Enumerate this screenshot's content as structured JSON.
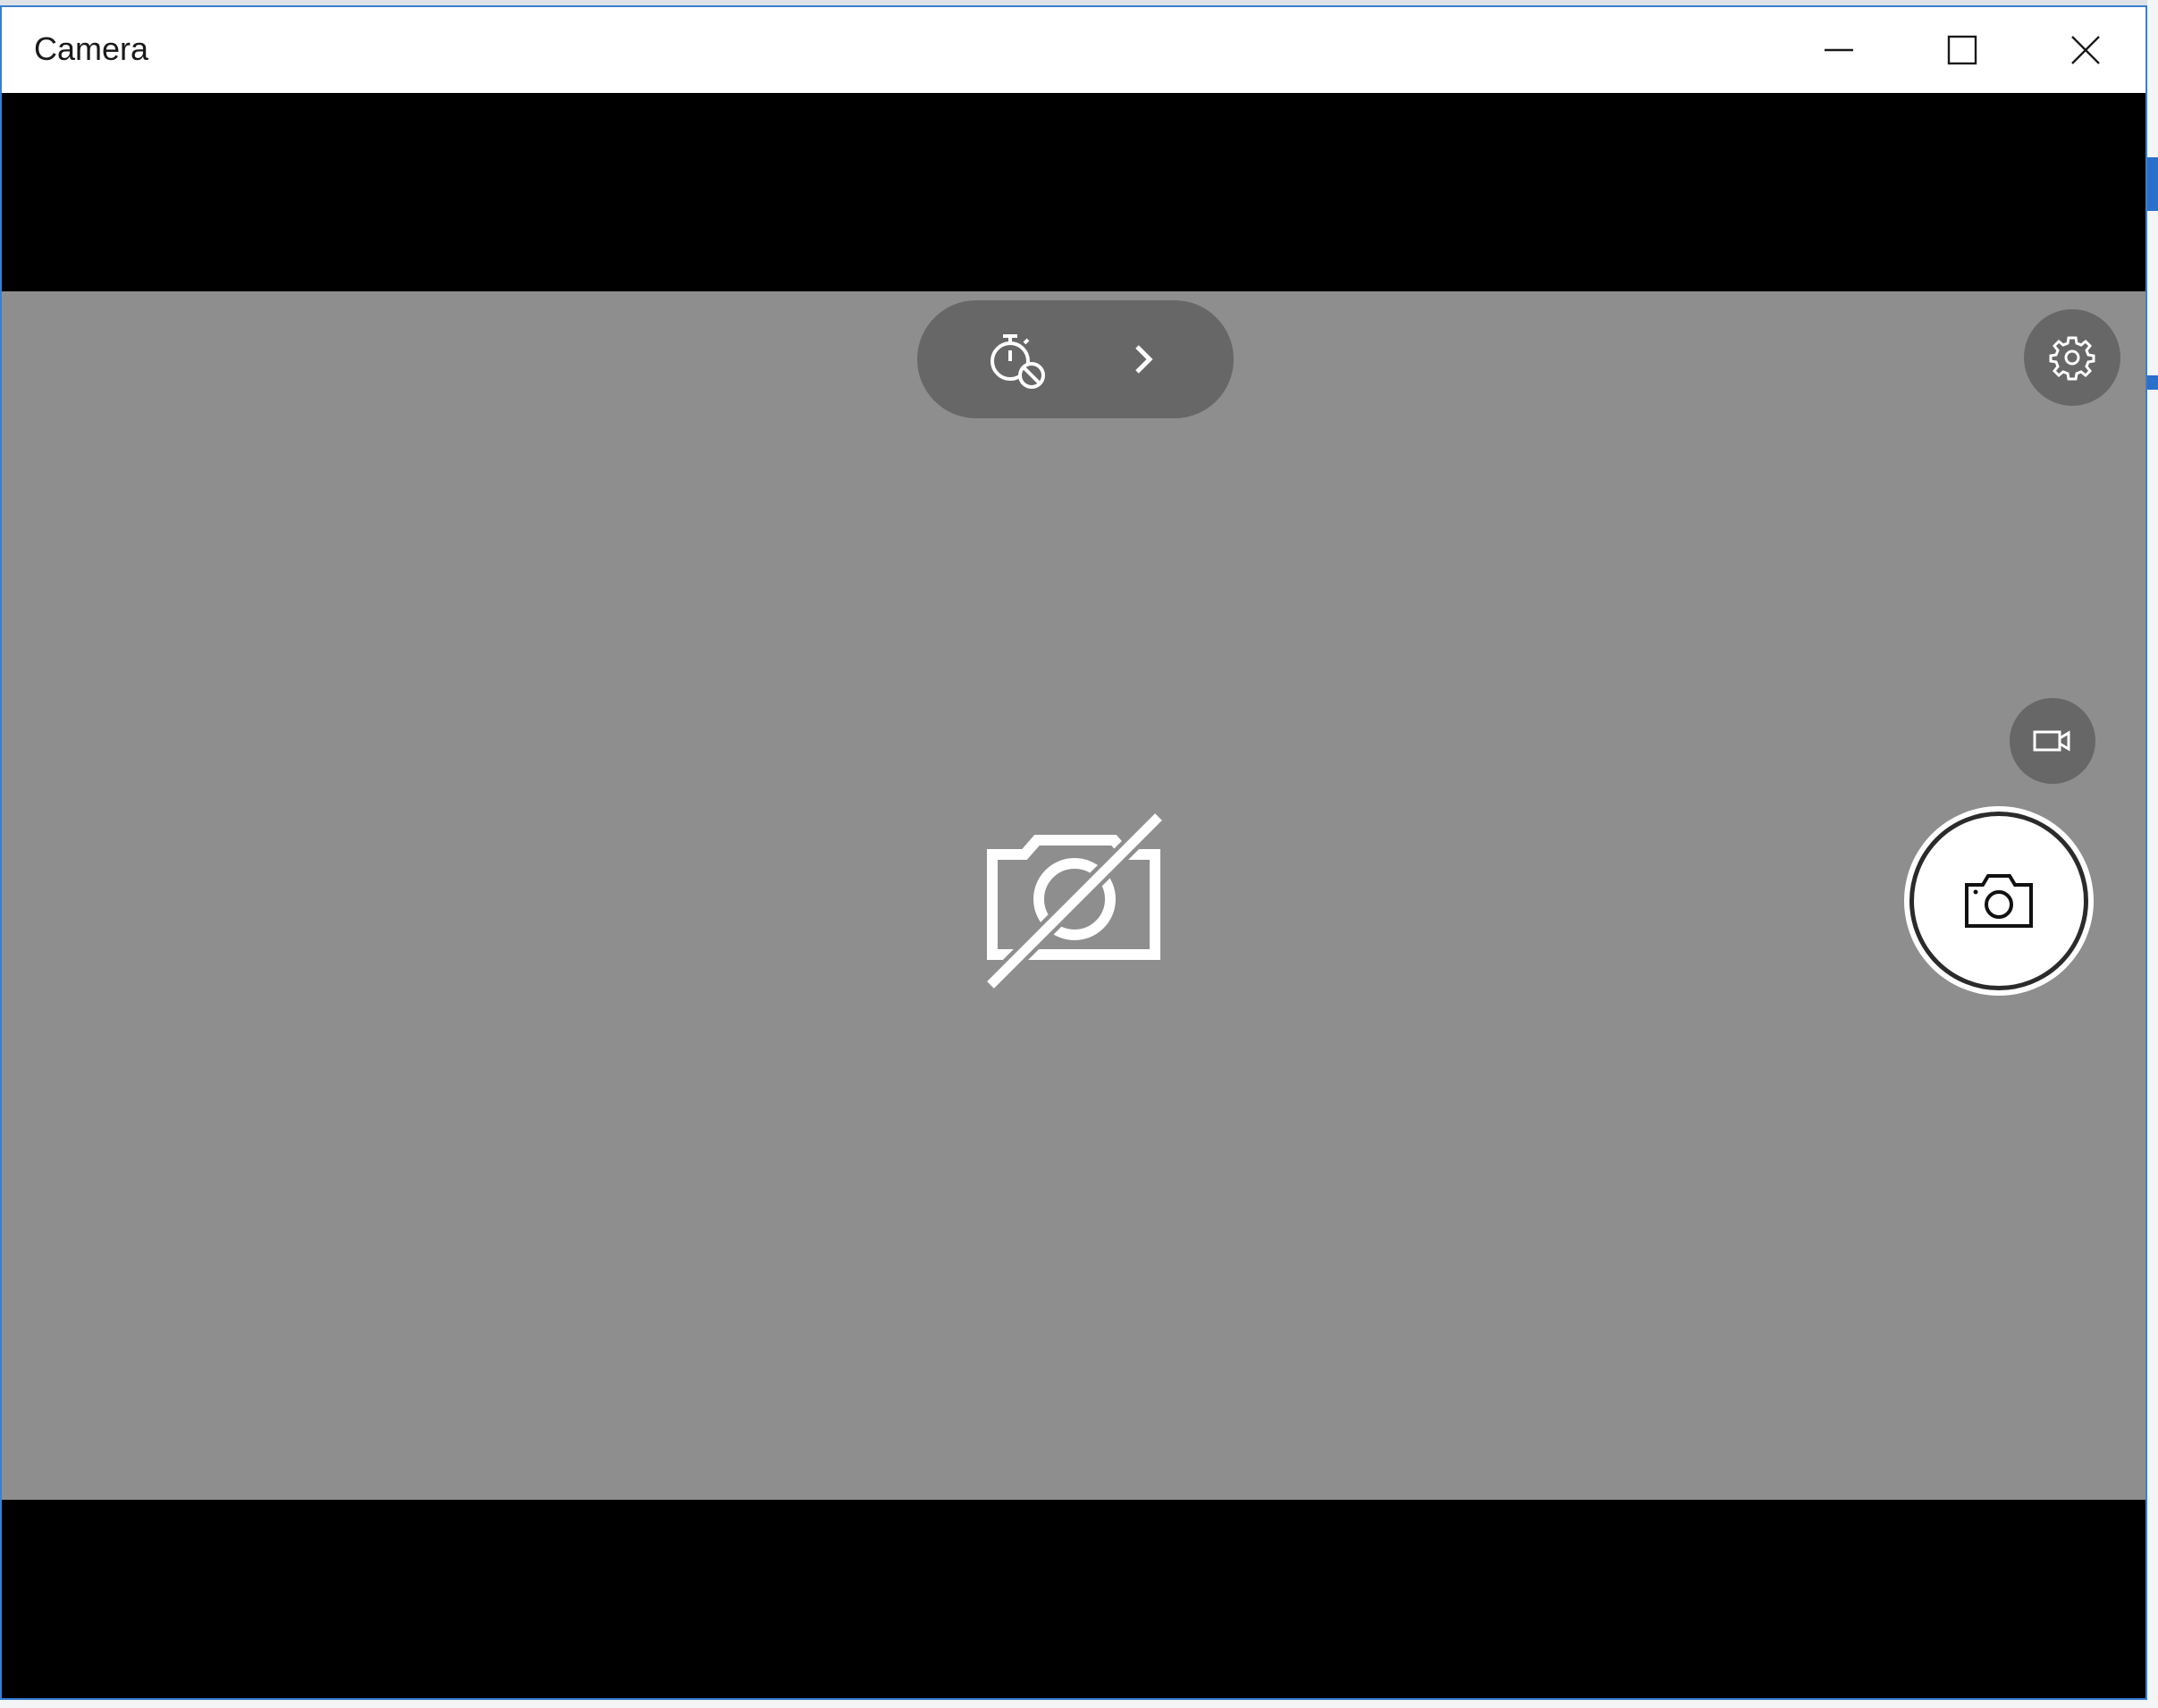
{
  "window": {
    "title": "Camera"
  },
  "caption_buttons": {
    "minimize": "minimize-icon",
    "maximize": "maximize-icon",
    "close": "close-icon"
  },
  "toolbar": {
    "timer_icon": "timer-off-icon",
    "expand_icon": "chevron-right-icon",
    "settings_icon": "gear-icon"
  },
  "capture": {
    "video_mode_icon": "video-camera-icon",
    "photo_shutter_icon": "camera-icon"
  },
  "viewfinder": {
    "state_icon": "no-camera-icon"
  },
  "colors": {
    "window_border": "#3a7fd0",
    "viewfinder_bg": "#8e8e8f",
    "control_bg": "#676767",
    "letterbox": "#000000"
  }
}
